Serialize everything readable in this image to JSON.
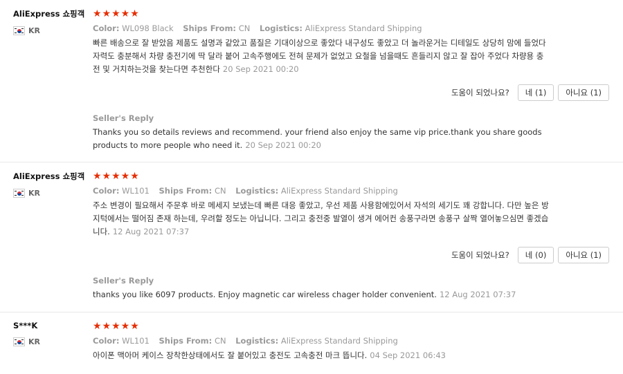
{
  "labels": {
    "color": "Color:",
    "ships_from": "Ships From:",
    "logistics": "Logistics:",
    "helpful": "도움이 되었나요?",
    "seller_reply": "Seller's Reply"
  },
  "rating_stars": "★★★★★",
  "colors": {
    "star": "#e62e04",
    "muted": "#999999",
    "text": "#333333"
  },
  "reviews": [
    {
      "user": "AliExpress 쇼핑객",
      "country": "KR",
      "rating": 5,
      "color": "WL098 Black",
      "ships_from": "CN",
      "logistics": "AliExpress Standard Shipping",
      "text": "빠른 배송으로 잘 받았음 제품도 설명과 같았고 품질은 기대이상으로 좋았다 내구성도 좋았고 더 놀라운거는 디테일도 상당히 맘에 들었다 자력도 충분해서 차량 충전기에 딱 달라 붙어 고속주행에도 전혀 문제가 없었고 요철을 넘을때도 흔들리지 않고 잘 잡아 주었다 차량용 충전 및 거치하는것을 찾는다면 추천한다",
      "date": "20 Sep 2021 00:20",
      "yes_label": "네 (1)",
      "no_label": "아니요 (1)",
      "reply": "Thanks you so details reviews and recommend. your friend also enjoy the same vip price.thank you share goods products to more people who need it.",
      "reply_date": "20 Sep 2021 00:20"
    },
    {
      "user": "AliExpress 쇼핑객",
      "country": "KR",
      "rating": 5,
      "color": "WL101",
      "ships_from": "CN",
      "logistics": "AliExpress Standard Shipping",
      "text": "주소 변경이 필요해서 주문후 바로 메세지 보냈는데 빠른 대응 좋았고, 우선 제품 사용함에있어서 자석의 세기도 꽤 강합니다. 다만 높은 방지턱에서는 떨어짐 존재 하는데, 우려할 정도는 아닙니다. 그리고 충전중 발열이 생겨 에어컨 송풍구라면 송풍구 살짝 열어놓으심면 좋겠습니다.",
      "date": "12 Aug 2021 07:37",
      "yes_label": "네 (0)",
      "no_label": "아니요 (1)",
      "reply": "thanks you like 6097 products. Enjoy magnetic car wireless chager holder convenient.",
      "reply_date": "12 Aug 2021 07:37"
    },
    {
      "user": "S***K",
      "country": "KR",
      "rating": 5,
      "color": "WL101",
      "ships_from": "CN",
      "logistics": "AliExpress Standard Shipping",
      "text": "아이폰 맥아머 케이스 장착한상태에서도 잘 붙어있고 충전도 고속충전 마크 뜹니다.",
      "date": "04 Sep 2021 06:43"
    }
  ]
}
